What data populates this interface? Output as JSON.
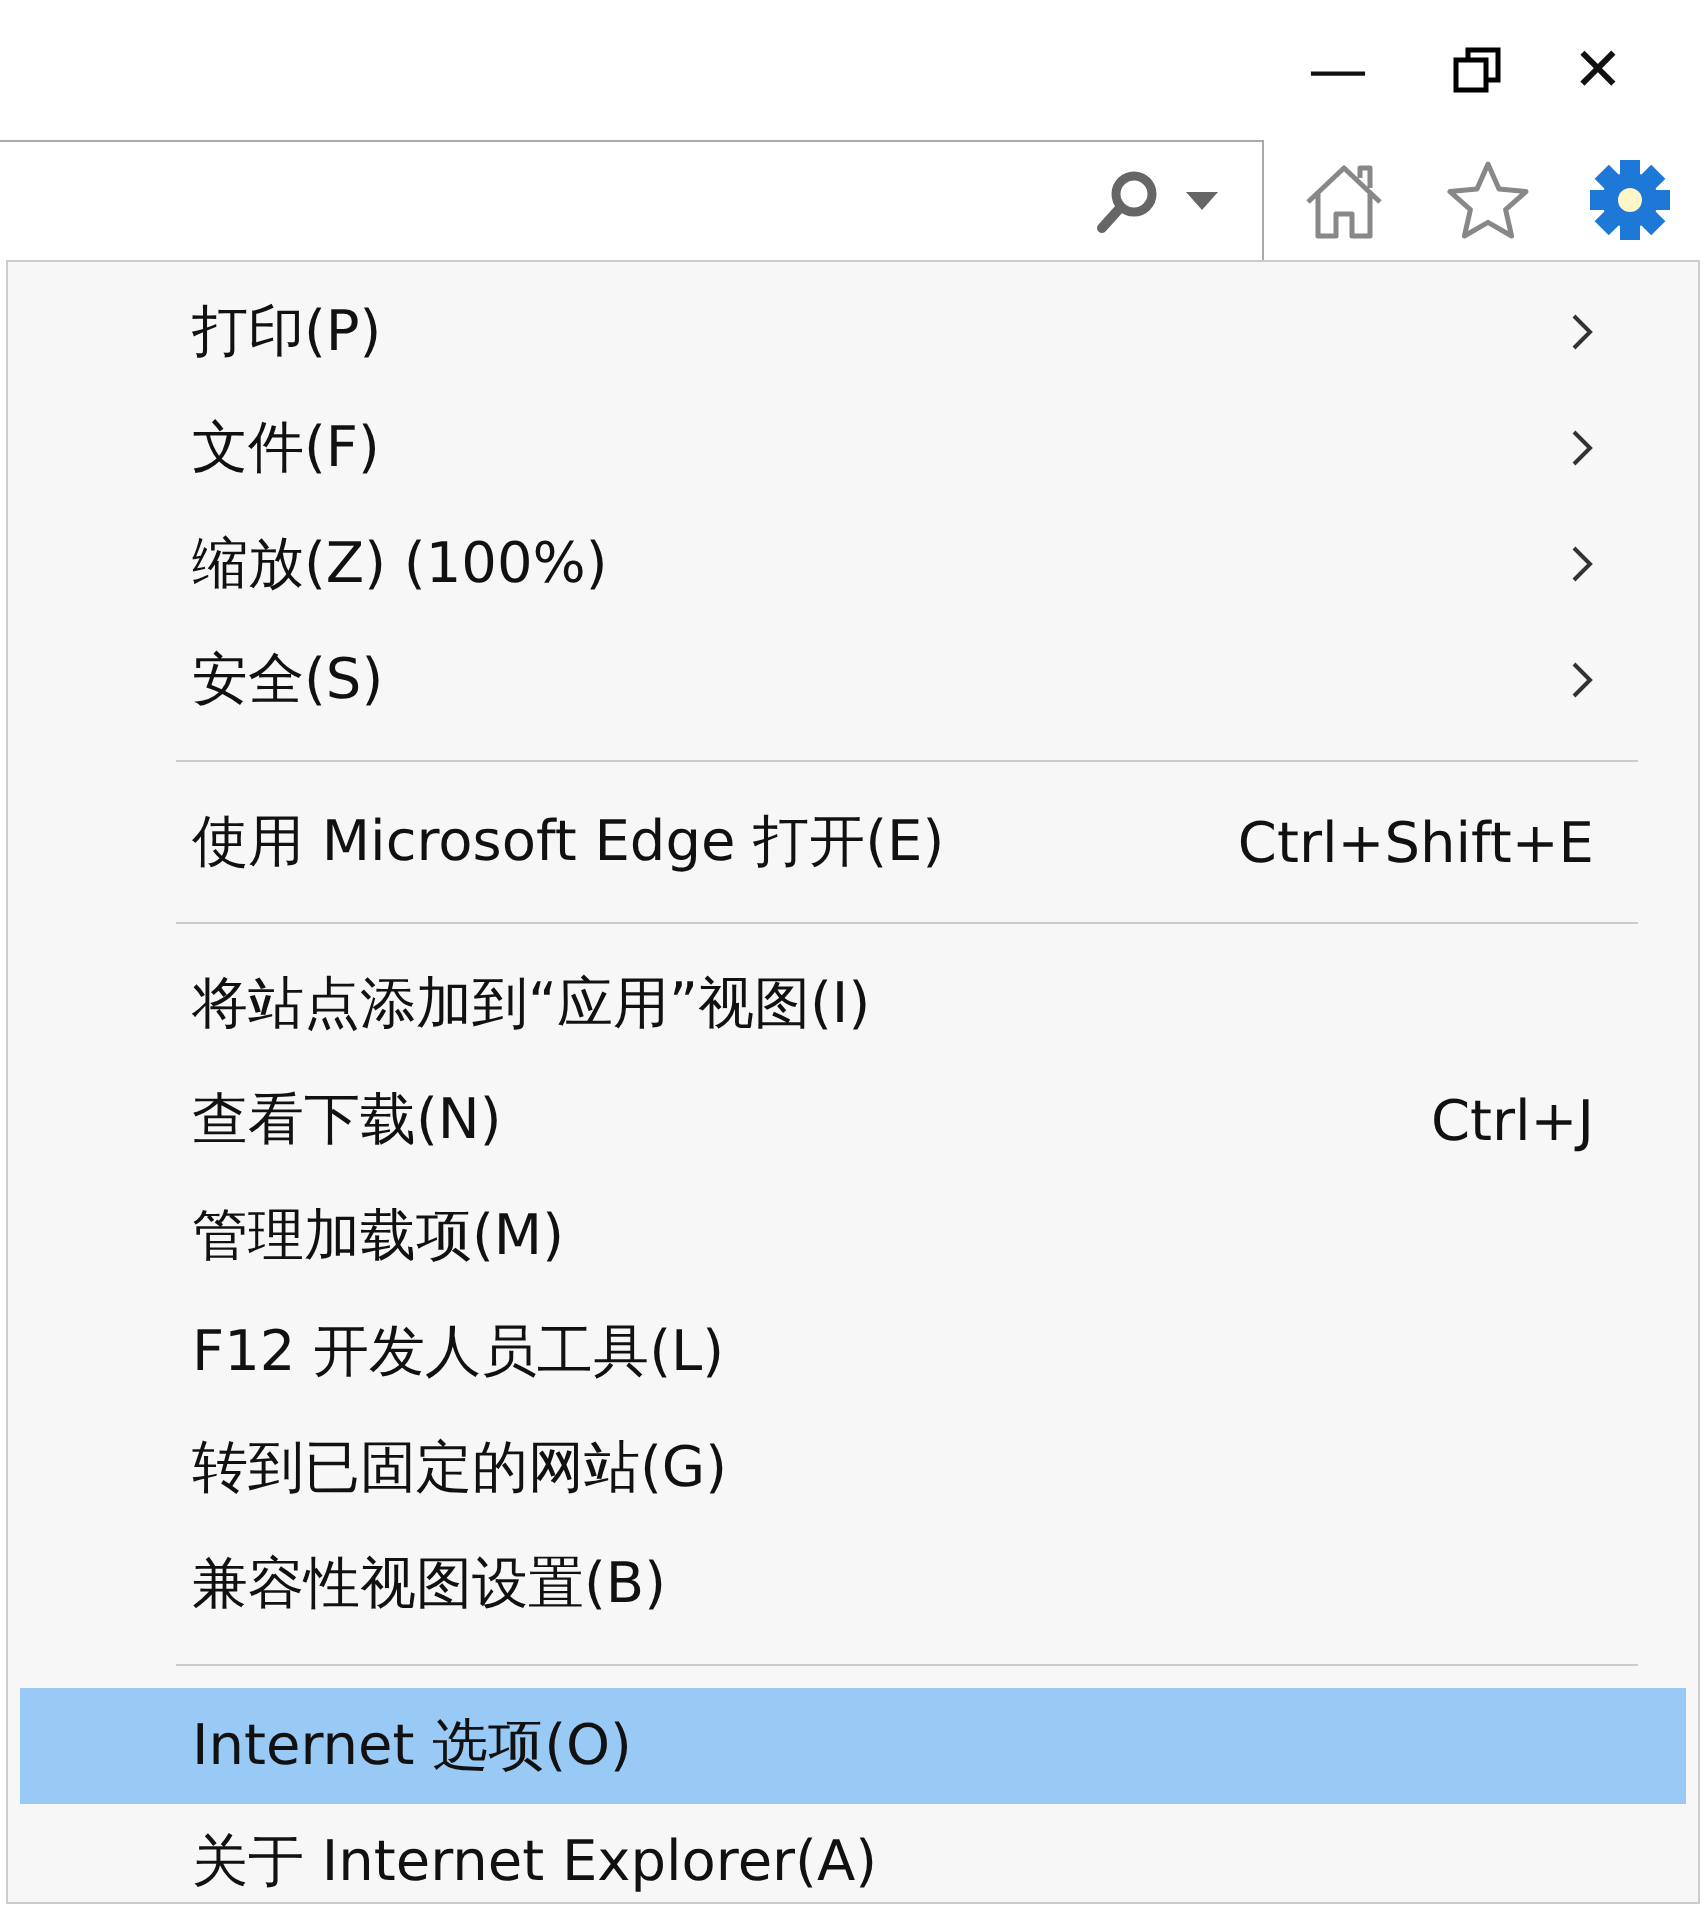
{
  "window_controls": {
    "minimize": "—",
    "close": "✕"
  },
  "menu": {
    "groups": [
      [
        {
          "label": "打印(P)",
          "submenu": true,
          "selected": false
        },
        {
          "label": "文件(F)",
          "submenu": true,
          "selected": false
        },
        {
          "label": "缩放(Z) (100%)",
          "submenu": true,
          "selected": false
        },
        {
          "label": "安全(S)",
          "submenu": true,
          "selected": false
        }
      ],
      [
        {
          "label": "使用 Microsoft Edge 打开(E)",
          "shortcut": "Ctrl+Shift+E",
          "submenu": false,
          "selected": false
        }
      ],
      [
        {
          "label": "将站点添加到“应用”视图(I)",
          "submenu": false,
          "selected": false
        },
        {
          "label": "查看下载(N)",
          "shortcut": "Ctrl+J",
          "submenu": false,
          "selected": false
        },
        {
          "label": "管理加载项(M)",
          "submenu": false,
          "selected": false
        },
        {
          "label": "F12 开发人员工具(L)",
          "submenu": false,
          "selected": false
        },
        {
          "label": "转到已固定的网站(G)",
          "submenu": false,
          "selected": false
        },
        {
          "label": "兼容性视图设置(B)",
          "submenu": false,
          "selected": false
        }
      ],
      [
        {
          "label": "Internet 选项(O)",
          "submenu": false,
          "selected": true
        },
        {
          "label": "关于 Internet Explorer(A)",
          "submenu": false,
          "selected": false
        }
      ]
    ]
  }
}
